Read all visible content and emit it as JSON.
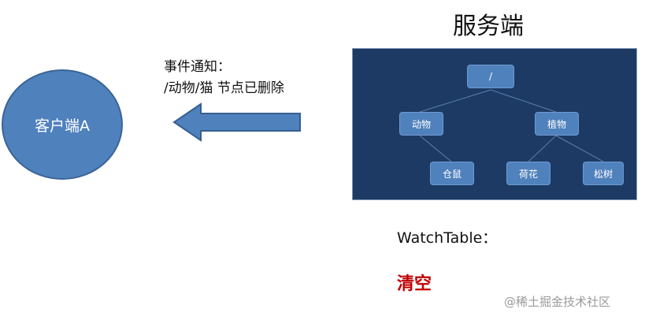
{
  "server": {
    "title": "服务端"
  },
  "client": {
    "label": "客户端A"
  },
  "notification": {
    "line1": "事件通知：",
    "line2": "/动物/猫 节点已删除"
  },
  "tree": {
    "root": "/",
    "nodes": {
      "animals": "动物",
      "plants": "植物",
      "hamster": "仓鼠",
      "lotus": "荷花",
      "pine": "松树"
    }
  },
  "watch_table": {
    "label": "WatchTable：",
    "status": "清空",
    "status_color": "#c00000"
  },
  "watermark": "@稀土掘金技术社区",
  "colors": {
    "node_fill": "#4f81bd",
    "panel_bg": "#1c3a64",
    "arrow_fill": "#4f81bd",
    "arrow_stroke": "#365f91"
  },
  "arrow": {
    "direction": "left",
    "from": "server",
    "to": "client"
  }
}
